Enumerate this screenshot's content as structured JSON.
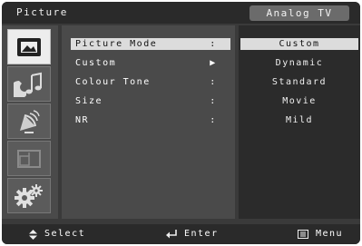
{
  "header": {
    "title": "Picture",
    "source": "Analog TV"
  },
  "sidebar": {
    "items": [
      {
        "icon": "picture-icon",
        "active": true
      },
      {
        "icon": "sound-icon",
        "active": false
      },
      {
        "icon": "channel-icon",
        "active": false
      },
      {
        "icon": "pip-icon",
        "active": false
      },
      {
        "icon": "setup-icon",
        "active": false
      }
    ]
  },
  "menu": {
    "items": [
      {
        "label": "Picture Mode",
        "indicator": ":"
      },
      {
        "label": "Custom",
        "indicator": "▶"
      },
      {
        "label": "Colour Tone",
        "indicator": ":"
      },
      {
        "label": "Size",
        "indicator": ":"
      },
      {
        "label": "NR",
        "indicator": ":"
      }
    ]
  },
  "options": {
    "items": [
      "Custom",
      "Dynamic",
      "Standard",
      "Movie",
      "Mild"
    ]
  },
  "footer": {
    "select": "Select",
    "enter": "Enter",
    "menu": "Menu"
  },
  "colors": {
    "frame": "#3a3a3a",
    "panel": "#4a4a4a",
    "options_panel": "#2b2b2b",
    "highlight": "#dcdcdc"
  }
}
